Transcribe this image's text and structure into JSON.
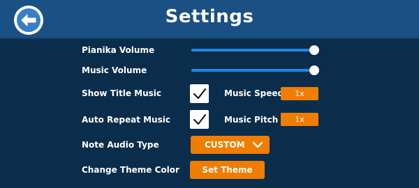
{
  "header": {
    "title": "Settings",
    "back_icon": "arrow-left-icon"
  },
  "settings": {
    "pianika_volume": {
      "label": "Pianika Volume",
      "value": 1.0
    },
    "music_volume": {
      "label": "Music Volume",
      "value": 1.0
    },
    "show_title_music": {
      "label": "Show Title Music",
      "checked": true
    },
    "music_speed": {
      "label": "Music Speed",
      "value": "1x"
    },
    "auto_repeat_music": {
      "label": "Auto Repeat Music",
      "checked": true
    },
    "music_pitch": {
      "label": "Music Pitch",
      "value": "1x"
    },
    "note_audio_type": {
      "label": "Note Audio Type",
      "selected": "CUSTOM"
    },
    "change_theme_color": {
      "label": "Change Theme Color",
      "button_label": "Set Theme"
    }
  },
  "colors": {
    "background": "#0b2d4c",
    "header": "#1a5084",
    "accent_orange": "#ef7d00",
    "slider_fill": "#1e88e5"
  }
}
